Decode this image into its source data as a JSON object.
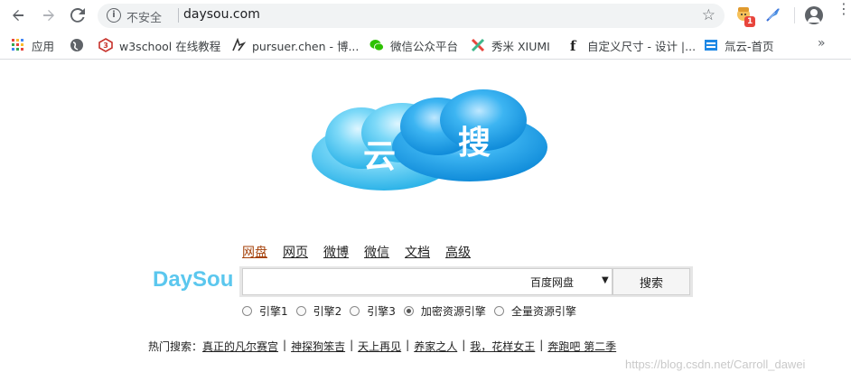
{
  "browser": {
    "url": "daysou.com",
    "insecure_label": "不安全",
    "extension_badge": "1"
  },
  "bookmarks": [
    {
      "label": "应用",
      "icon": "apps-grid-icon"
    },
    {
      "label": "",
      "icon": "globe-icon"
    },
    {
      "label": "w3school 在线教程",
      "icon": "w3school-icon"
    },
    {
      "label": "pursuer.chen - 博...",
      "icon": "pursuer-icon"
    },
    {
      "label": "微信公众平台",
      "icon": "wechat-icon"
    },
    {
      "label": "秀米 XIUMI",
      "icon": "xiumi-icon"
    },
    {
      "label": "自定义尺寸 - 设计 |...",
      "icon": "f-icon"
    },
    {
      "label": "氚云-首页",
      "icon": "h3yun-icon"
    }
  ],
  "bookmarks_more": "»",
  "logo": {
    "left_char": "云",
    "right_char": "搜"
  },
  "tabs": [
    "网盘",
    "网页",
    "微博",
    "微信",
    "文档",
    "高级"
  ],
  "active_tab": "网盘",
  "brand": "DaySou",
  "search": {
    "value": "",
    "engine_selected": "百度网盘",
    "button": "搜索"
  },
  "engines": [
    {
      "label": "引擎1",
      "checked": false
    },
    {
      "label": "引擎2",
      "checked": false
    },
    {
      "label": "引擎3",
      "checked": false
    },
    {
      "label": "加密资源引擎",
      "checked": true
    },
    {
      "label": "全量资源引擎",
      "checked": false
    }
  ],
  "hot": {
    "label": "热门搜索：",
    "items": [
      "真正的凡尔赛宫",
      "神探狗笨吉",
      "天上再见",
      "养家之人",
      "我，花样女王",
      "奔跑吧 第二季"
    ]
  },
  "watermark": "https://blog.csdn.net/Carroll_dawei",
  "colors": {
    "brand": "#5bc7ee",
    "active_tab": "#a5420b",
    "cloud_light": "#5fd0f5",
    "cloud_dark": "#1a9ee8"
  }
}
